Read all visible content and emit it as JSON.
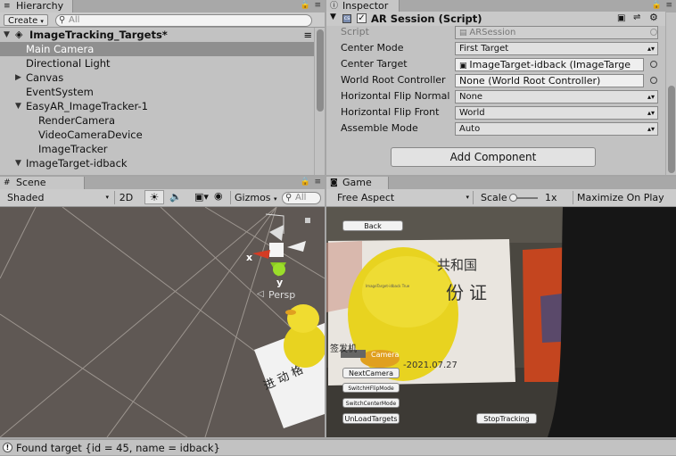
{
  "hierarchy": {
    "tab": "Hierarchy",
    "create_label": "Create",
    "search_placeholder": "All",
    "scene_name": "ImageTracking_Targets*",
    "items": [
      {
        "label": "Main Camera"
      },
      {
        "label": "Directional Light"
      },
      {
        "label": "Canvas"
      },
      {
        "label": "EventSystem"
      },
      {
        "label": "EasyAR_ImageTracker-1"
      },
      {
        "label": "RenderCamera"
      },
      {
        "label": "VideoCameraDevice"
      },
      {
        "label": "ImageTracker"
      },
      {
        "label": "ImageTarget-idback"
      }
    ]
  },
  "inspector": {
    "tab": "Inspector",
    "component_title": "AR Session (Script)",
    "add_component": "Add Component",
    "props": [
      {
        "label": "Script",
        "value": "ARSession"
      },
      {
        "label": "Center Mode",
        "value": "First Target"
      },
      {
        "label": "Center Target",
        "value": "ImageTarget-idback (ImageTarge"
      },
      {
        "label": "World Root Controller",
        "value": "None (World Root Controller)"
      },
      {
        "label": "Horizontal Flip Normal",
        "value": "None"
      },
      {
        "label": "Horizontal Flip Front",
        "value": "World"
      },
      {
        "label": "Assemble Mode",
        "value": "Auto"
      }
    ]
  },
  "scene": {
    "tab": "Scene",
    "shading": "Shaded",
    "mode_2d": "2D",
    "gizmos": "Gizmos",
    "search_placeholder": "All",
    "persp_label": "Persp",
    "axis_x": "x",
    "axis_y": "y"
  },
  "game": {
    "tab": "Game",
    "aspect": "Free Aspect",
    "scale_label": "Scale",
    "scale_value": "1x",
    "maximize": "Maximize On Play",
    "back": "Back",
    "camera_label": "Camera",
    "card_text_1": "共和国",
    "card_text_2": "份证",
    "card_date": "-2021.07.27",
    "card_prefix": "签发机",
    "buttons": [
      "NextCamera",
      "SwitchHFlipMode",
      "SwitchCenterMode",
      "UnLoadTargets"
    ],
    "stop_tracking": "StopTracking"
  },
  "status": {
    "message": "Found target {id = 45, name = idback}"
  },
  "colors": {
    "panel": "#c2c2c2",
    "selection": "#8f8f8f",
    "scene_bg": "#5f5854",
    "duck": "#e8d320"
  }
}
